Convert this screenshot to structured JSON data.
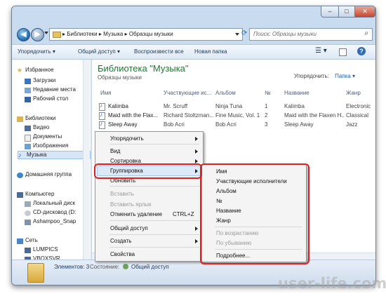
{
  "window": {
    "controls": [
      "–",
      "□",
      "✕"
    ],
    "back": "◀",
    "forward": "▶",
    "breadcrumb": [
      "Библиотеки",
      "Музыка",
      "Образцы музыки"
    ],
    "search_placeholder": "Поиск: Образцы музыки"
  },
  "toolbar": {
    "organize": "Упорядочить",
    "share": "Общий доступ",
    "play_all": "Воспроизвести все",
    "new_folder": "Новая папка"
  },
  "sidebar": {
    "favorites": "Избранное",
    "downloads": "Загрузки",
    "recent": "Недавние места",
    "desktop": "Рабочий стол",
    "libraries": "Библиотеки",
    "video": "Видео",
    "documents": "Документы",
    "images": "Изображения",
    "music": "Музыка",
    "homegroup": "Домашняя группа",
    "computer": "Компьютер",
    "local_disk": "Локальный диск",
    "cd_drive": "CD-дисковод (D:",
    "ashampoo": "Ashampoo_Snap",
    "network": "Сеть",
    "lumpics": "LUMPICS",
    "vboxsvr": "VBOXSVR"
  },
  "content": {
    "title": "Библиотека \"Музыка\"",
    "subtitle": "Образцы музыки",
    "arrange_label": "Упорядочить:",
    "arrange_value": "Папка",
    "columns": [
      "Имя",
      "Участвующие ис...",
      "Альбом",
      "№",
      "Название",
      "Жанр"
    ],
    "rows": [
      [
        "Kalimba",
        "Mr. Scruff",
        "Ninja Tuna",
        "1",
        "Kalimba",
        "Electronic"
      ],
      [
        "Maid with the Flax...",
        "Richard Stoltzman...",
        "Fine Music, Vol. 1",
        "2",
        "Maid with the Flaxen H...",
        "Classical"
      ],
      [
        "Sleep Away",
        "Bob Acri",
        "Bob Acri",
        "3",
        "Sleep Away",
        "Jazz"
      ]
    ]
  },
  "status": {
    "items_count": "Элементов: 3",
    "state_label": "Состояние:",
    "state_value": "Общий доступ"
  },
  "context_menu": {
    "arrange": "Упорядочить",
    "view": "Вид",
    "sort": "Сортировка",
    "group": "Группировка",
    "refresh": "Обновить",
    "paste": "Вставить",
    "paste_shortcut": "Вставить ярлык",
    "undo_delete": "Отменить удаление",
    "undo_shortcut": "CTRL+Z",
    "share": "Общий доступ",
    "create": "Создать",
    "properties": "Свойства"
  },
  "submenu": {
    "name": "Имя",
    "artists": "Участвующие исполнители",
    "album": "Альбом",
    "number": "№",
    "title": "Название",
    "genre": "Жанр",
    "ascending": "По возрастанию",
    "descending": "По убыванию",
    "more": "Подробнее..."
  },
  "watermark": "user-life.com",
  "colors": {
    "highlight_box": "#e02020",
    "library_title": "#1a7a2d"
  }
}
